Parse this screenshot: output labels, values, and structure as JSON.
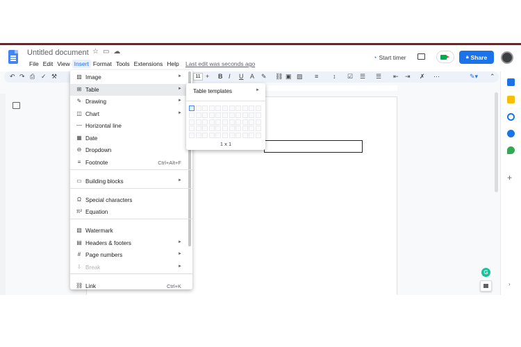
{
  "document": {
    "title": "Untitled document",
    "last_edit": "Last edit was seconds ago"
  },
  "menubar": [
    "File",
    "Edit",
    "View",
    "Insert",
    "Format",
    "Tools",
    "Extensions",
    "Help"
  ],
  "header": {
    "start_timer": "Start timer",
    "share": "Share"
  },
  "toolbar": {
    "font_size": "11"
  },
  "insert_menu": {
    "items": [
      {
        "label": "Image",
        "icon": "image-icon",
        "arrow": "►",
        "shortcut": ""
      },
      {
        "label": "Table",
        "icon": "table-icon",
        "arrow": "►",
        "shortcut": ""
      },
      {
        "label": "Drawing",
        "icon": "drawing-icon",
        "arrow": "►",
        "shortcut": ""
      },
      {
        "label": "Chart",
        "icon": "chart-icon",
        "arrow": "►",
        "shortcut": ""
      },
      {
        "label": "Horizontal line",
        "icon": "horizontal-line-icon",
        "arrow": "",
        "shortcut": ""
      },
      {
        "label": "Date",
        "icon": "date-icon",
        "arrow": "",
        "shortcut": ""
      },
      {
        "label": "Dropdown",
        "icon": "dropdown-icon",
        "arrow": "",
        "shortcut": ""
      },
      {
        "label": "Footnote",
        "icon": "footnote-icon",
        "arrow": "",
        "shortcut": "Ctrl+Alt+F"
      },
      {
        "label": "Building blocks",
        "icon": "building-blocks-icon",
        "arrow": "►",
        "shortcut": ""
      },
      {
        "label": "Special characters",
        "icon": "omega-icon",
        "arrow": "",
        "shortcut": ""
      },
      {
        "label": "Equation",
        "icon": "equation-icon",
        "arrow": "",
        "shortcut": ""
      },
      {
        "label": "Watermark",
        "icon": "watermark-icon",
        "arrow": "",
        "shortcut": ""
      },
      {
        "label": "Headers & footers",
        "icon": "headers-footers-icon",
        "arrow": "►",
        "shortcut": ""
      },
      {
        "label": "Page numbers",
        "icon": "hash-icon",
        "arrow": "►",
        "shortcut": ""
      },
      {
        "label": "Break",
        "icon": "break-icon",
        "arrow": "►",
        "shortcut": ""
      },
      {
        "label": "Link",
        "icon": "link-icon",
        "arrow": "",
        "shortcut": "Ctrl+K"
      }
    ]
  },
  "table_submenu": {
    "templates_label": "Table templates",
    "size_label": "1 x 1"
  }
}
